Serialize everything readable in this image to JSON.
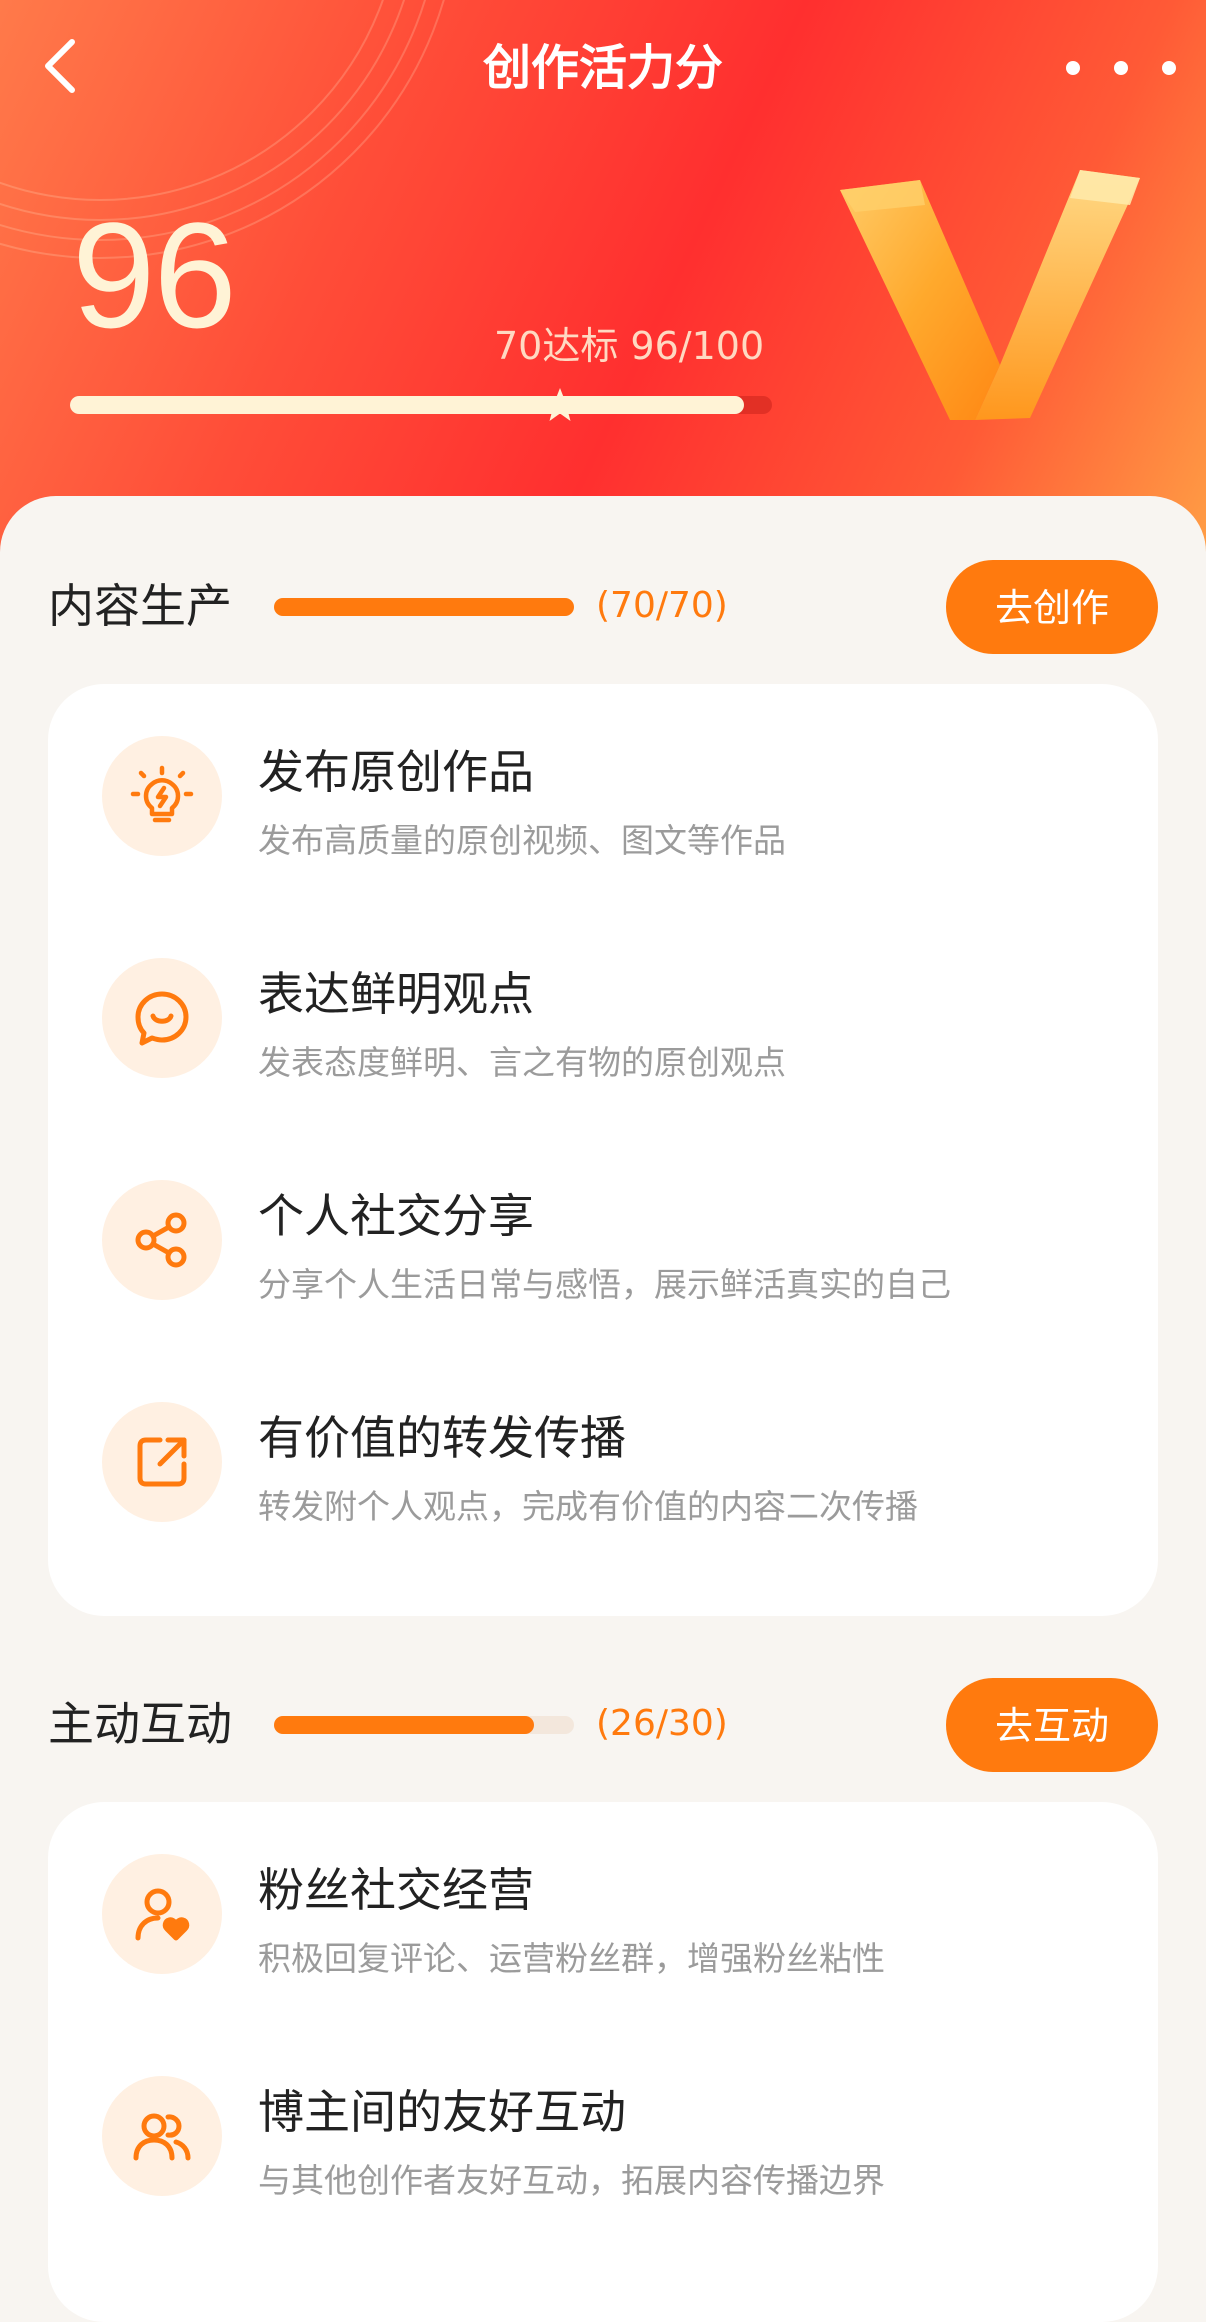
{
  "nav": {
    "title": "创作活力分",
    "back_icon": "chevron-left-icon",
    "more_icon": "more-horizontal-icon"
  },
  "score": {
    "value": "96",
    "target_text": "70达标 96/100",
    "progress_fraction": 0.96,
    "target_fraction": 0.7
  },
  "sections": [
    {
      "title": "内容生产",
      "count": "(70/70)",
      "progress_fraction": 1.0,
      "button": "去创作",
      "items": [
        {
          "title": "发布原创作品",
          "desc": "发布高质量的原创视频、图文等作品",
          "icon": "lightbulb-icon"
        },
        {
          "title": "表达鲜明观点",
          "desc": "发表态度鲜明、言之有物的原创观点",
          "icon": "chat-bubble-icon"
        },
        {
          "title": "个人社交分享",
          "desc": "分享个人生活日常与感悟，展示鲜活真实的自己",
          "icon": "share-icon"
        },
        {
          "title": "有价值的转发传播",
          "desc": "转发附个人观点，完成有价值的内容二次传播",
          "icon": "forward-icon"
        }
      ]
    },
    {
      "title": "主动互动",
      "count": "(26/30)",
      "progress_fraction": 0.8667,
      "button": "去互动",
      "items": [
        {
          "title": "粉丝社交经营",
          "desc": "积极回复评论、运营粉丝群，增强粉丝粘性",
          "icon": "user-heart-icon"
        },
        {
          "title": "博主间的友好互动",
          "desc": "与其他创作者友好互动，拓展内容传播边界",
          "icon": "users-icon"
        }
      ]
    }
  ],
  "colors": {
    "accent": "#ff7a0e",
    "header_red": "#ff2f2f",
    "score_cream": "#fff3d6"
  }
}
